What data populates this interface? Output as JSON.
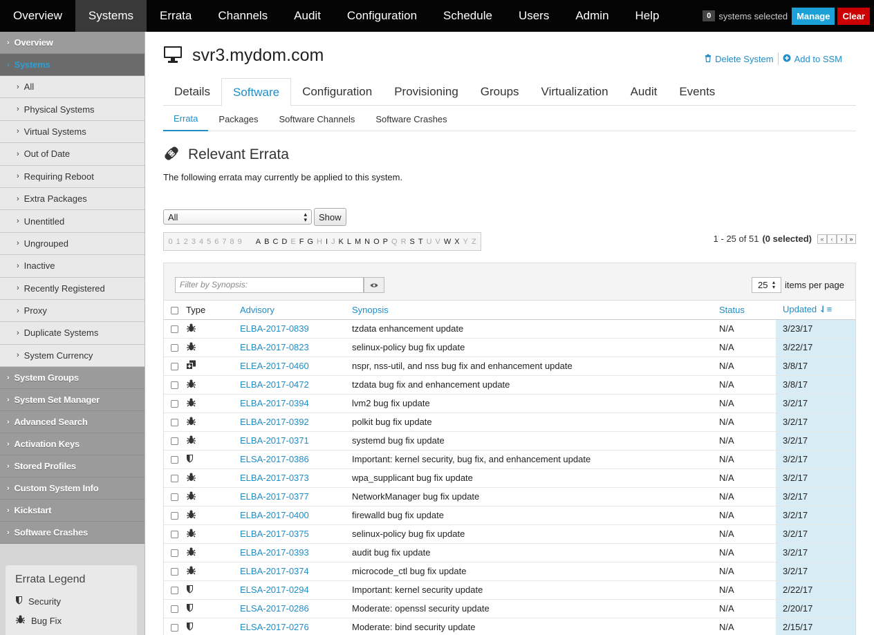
{
  "topnav": {
    "items": [
      "Overview",
      "Systems",
      "Errata",
      "Channels",
      "Audit",
      "Configuration",
      "Schedule",
      "Users",
      "Admin",
      "Help"
    ],
    "active": "Systems",
    "selected_count": "0",
    "selected_text": "systems selected",
    "manage_label": "Manage",
    "clear_label": "Clear"
  },
  "sidebar": {
    "overview": "Overview",
    "systems": "Systems",
    "sub_items": [
      "All",
      "Physical Systems",
      "Virtual Systems",
      "Out of Date",
      "Requiring Reboot",
      "Extra Packages",
      "Unentitled",
      "Ungrouped",
      "Inactive",
      "Recently Registered",
      "Proxy",
      "Duplicate Systems",
      "System Currency"
    ],
    "bottom_items": [
      "System Groups",
      "System Set Manager",
      "Advanced Search",
      "Activation Keys",
      "Stored Profiles",
      "Custom System Info",
      "Kickstart",
      "Software Crashes"
    ],
    "legend": {
      "title": "Errata Legend",
      "security": "Security",
      "bugfix": "Bug Fix"
    }
  },
  "system": {
    "name": "svr3.mydom.com",
    "delete_label": "Delete System",
    "add_ssm_label": "Add to SSM"
  },
  "tabs": [
    "Details",
    "Software",
    "Configuration",
    "Provisioning",
    "Groups",
    "Virtualization",
    "Audit",
    "Events"
  ],
  "subtabs": [
    "Errata",
    "Packages",
    "Software Channels",
    "Software Crashes"
  ],
  "section": {
    "title": "Relevant Errata",
    "description": "The following errata may currently be applied to this system."
  },
  "filter": {
    "select_value": "All",
    "show_label": "Show"
  },
  "alpha": {
    "digits": [
      "0",
      "1",
      "2",
      "3",
      "4",
      "5",
      "6",
      "7",
      "8",
      "9"
    ],
    "letters": [
      {
        "c": "A",
        "on": true
      },
      {
        "c": "B",
        "on": true
      },
      {
        "c": "C",
        "on": true
      },
      {
        "c": "D",
        "on": true
      },
      {
        "c": "E",
        "on": false
      },
      {
        "c": "F",
        "on": true
      },
      {
        "c": "G",
        "on": true
      },
      {
        "c": "H",
        "on": false
      },
      {
        "c": "I",
        "on": true
      },
      {
        "c": "J",
        "on": false
      },
      {
        "c": "K",
        "on": true
      },
      {
        "c": "L",
        "on": true
      },
      {
        "c": "M",
        "on": true
      },
      {
        "c": "N",
        "on": true
      },
      {
        "c": "O",
        "on": true
      },
      {
        "c": "P",
        "on": true
      },
      {
        "c": "Q",
        "on": false
      },
      {
        "c": "R",
        "on": false
      },
      {
        "c": "S",
        "on": true
      },
      {
        "c": "T",
        "on": true
      },
      {
        "c": "U",
        "on": false
      },
      {
        "c": "V",
        "on": false
      },
      {
        "c": "W",
        "on": true
      },
      {
        "c": "X",
        "on": true
      },
      {
        "c": "Y",
        "on": false
      },
      {
        "c": "Z",
        "on": false
      }
    ]
  },
  "pagination": {
    "range": "1 - 25 of 51",
    "selected": "(0 selected)"
  },
  "table": {
    "search_placeholder": "Filter by Synopsis:",
    "per_page": "25",
    "per_page_label": "items per page",
    "headers": {
      "type": "Type",
      "advisory": "Advisory",
      "synopsis": "Synopsis",
      "status": "Status",
      "updated": "Updated"
    },
    "rows": [
      {
        "type": "bug",
        "advisory": "ELBA-2017-0839",
        "synopsis": "tzdata enhancement update",
        "status": "N/A",
        "updated": "3/23/17"
      },
      {
        "type": "bug",
        "advisory": "ELBA-2017-0823",
        "synopsis": "selinux-policy bug fix update",
        "status": "N/A",
        "updated": "3/22/17"
      },
      {
        "type": "enh",
        "advisory": "ELEA-2017-0460",
        "synopsis": "nspr, nss-util, and nss bug fix and enhancement update",
        "status": "N/A",
        "updated": "3/8/17"
      },
      {
        "type": "bug",
        "advisory": "ELBA-2017-0472",
        "synopsis": "tzdata bug fix and enhancement update",
        "status": "N/A",
        "updated": "3/8/17"
      },
      {
        "type": "bug",
        "advisory": "ELBA-2017-0394",
        "synopsis": "lvm2 bug fix update",
        "status": "N/A",
        "updated": "3/2/17"
      },
      {
        "type": "bug",
        "advisory": "ELBA-2017-0392",
        "synopsis": "polkit bug fix update",
        "status": "N/A",
        "updated": "3/2/17"
      },
      {
        "type": "bug",
        "advisory": "ELBA-2017-0371",
        "synopsis": "systemd bug fix update",
        "status": "N/A",
        "updated": "3/2/17"
      },
      {
        "type": "sec",
        "advisory": "ELSA-2017-0386",
        "synopsis": "Important: kernel security, bug fix, and enhancement update",
        "status": "N/A",
        "updated": "3/2/17"
      },
      {
        "type": "bug",
        "advisory": "ELBA-2017-0373",
        "synopsis": "wpa_supplicant bug fix update",
        "status": "N/A",
        "updated": "3/2/17"
      },
      {
        "type": "bug",
        "advisory": "ELBA-2017-0377",
        "synopsis": "NetworkManager bug fix update",
        "status": "N/A",
        "updated": "3/2/17"
      },
      {
        "type": "bug",
        "advisory": "ELBA-2017-0400",
        "synopsis": "firewalld bug fix update",
        "status": "N/A",
        "updated": "3/2/17"
      },
      {
        "type": "bug",
        "advisory": "ELBA-2017-0375",
        "synopsis": "selinux-policy bug fix update",
        "status": "N/A",
        "updated": "3/2/17"
      },
      {
        "type": "bug",
        "advisory": "ELBA-2017-0393",
        "synopsis": "audit bug fix update",
        "status": "N/A",
        "updated": "3/2/17"
      },
      {
        "type": "bug",
        "advisory": "ELBA-2017-0374",
        "synopsis": "microcode_ctl bug fix update",
        "status": "N/A",
        "updated": "3/2/17"
      },
      {
        "type": "sec",
        "advisory": "ELSA-2017-0294",
        "synopsis": "Important: kernel security update",
        "status": "N/A",
        "updated": "2/22/17"
      },
      {
        "type": "sec",
        "advisory": "ELSA-2017-0286",
        "synopsis": "Moderate: openssl security update",
        "status": "N/A",
        "updated": "2/20/17"
      },
      {
        "type": "sec",
        "advisory": "ELSA-2017-0276",
        "synopsis": "Moderate: bind security update",
        "status": "N/A",
        "updated": "2/15/17"
      }
    ]
  },
  "colors": {
    "accent": "#1f8dc7",
    "clear": "#cc0000",
    "manage": "#1ba0d8"
  }
}
